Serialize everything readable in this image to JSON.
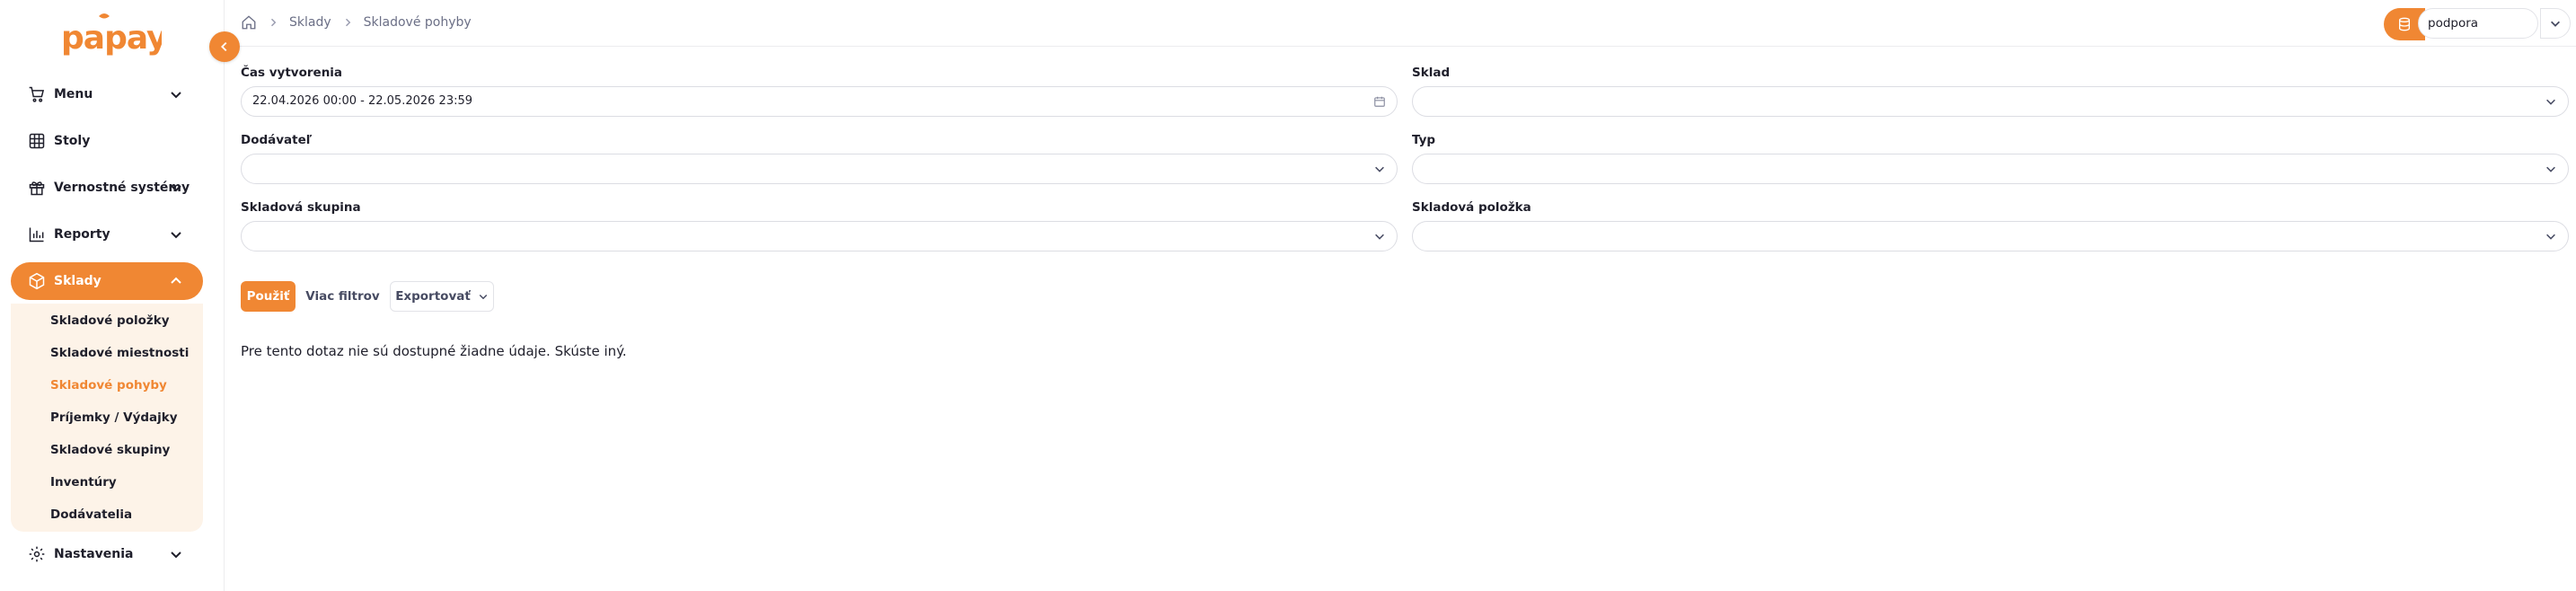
{
  "app": {
    "logo_text": "papaya",
    "brand_color": "#f08733"
  },
  "sidebar": {
    "items": [
      {
        "label": "Menu",
        "icon": "cart-icon",
        "expandable": true
      },
      {
        "label": "Stoly",
        "icon": "table-grid-icon",
        "expandable": false
      },
      {
        "label": "Vernostné systémy",
        "icon": "gift-icon",
        "expandable": true
      },
      {
        "label": "Reporty",
        "icon": "bar-chart-icon",
        "expandable": true
      },
      {
        "label": "Sklady",
        "icon": "box-icon",
        "expandable": true,
        "active": true
      },
      {
        "label": "Nastavenia",
        "icon": "gear-icon",
        "expandable": true
      }
    ],
    "submenu": [
      {
        "label": "Skladové položky"
      },
      {
        "label": "Skladové miestnosti"
      },
      {
        "label": "Skladové pohyby",
        "active": true
      },
      {
        "label": "Príjemky / Výdajky"
      },
      {
        "label": "Skladové skupiny"
      },
      {
        "label": "Inventúry"
      },
      {
        "label": "Dodávatelia"
      }
    ]
  },
  "topbar": {
    "breadcrumb": [
      "Sklady",
      "Skladové pohyby"
    ],
    "store_select": {
      "value": "podpora"
    }
  },
  "filters": {
    "created": {
      "label": "Čas vytvorenia",
      "value": "22.04.2026 00:00 - 22.05.2026 23:59"
    },
    "warehouse": {
      "label": "Sklad",
      "value": ""
    },
    "supplier": {
      "label": "Dodávateľ",
      "value": ""
    },
    "type": {
      "label": "Typ",
      "value": ""
    },
    "group": {
      "label": "Skladová skupina",
      "value": ""
    },
    "item": {
      "label": "Skladová položka",
      "value": ""
    }
  },
  "actions": {
    "apply": "Použiť",
    "more_filters": "Viac filtrov",
    "export": "Exportovať"
  },
  "results": {
    "empty_message": "Pre tento dotaz nie sú dostupné žiadne údaje. Skúste iný."
  }
}
